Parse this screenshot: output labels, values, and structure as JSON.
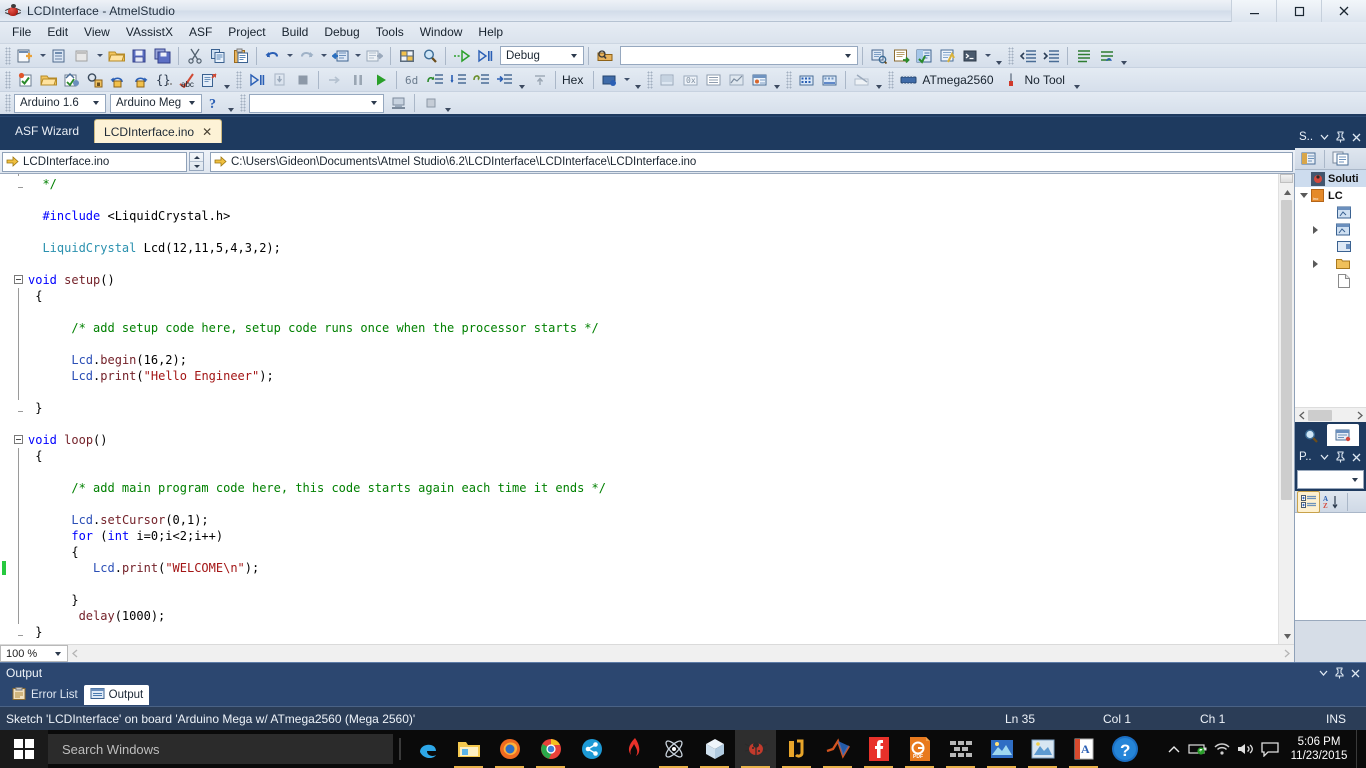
{
  "window": {
    "title": "LCDInterface - AtmelStudio",
    "app_icon": "ladybug-icon",
    "minimize_label": "Minimize",
    "maximize_label": "Maximize",
    "close_label": "Close"
  },
  "menu": {
    "items": [
      "File",
      "Edit",
      "View",
      "VAssistX",
      "ASF",
      "Project",
      "Build",
      "Debug",
      "Tools",
      "Window",
      "Help"
    ]
  },
  "toolbar_row1": {
    "new_project": "new-project-icon",
    "add_item": "add-item-icon",
    "new_file": "new-file-icon",
    "open": "open-folder-icon",
    "save": "save-icon",
    "save_all": "save-all-icon",
    "cut": "cut-icon",
    "copy": "copy-icon",
    "paste": "paste-icon",
    "undo": "undo-icon",
    "redo": "redo-icon",
    "navigate_back": "navigate-back-icon",
    "navigate_forward": "navigate-forward-icon",
    "solution_explorer": "solution-explorer-icon",
    "find": "find-icon",
    "start_debug": "start-debugging-icon",
    "step": "step-icon",
    "configuration": "Debug",
    "find_combo_value": "",
    "find_combo_placeholder": "",
    "quick_find": "quick-find-icon",
    "properties_win": "properties-window-icon",
    "goto": "goto-icon",
    "object_browser": "object-browser-icon",
    "quick_watch": "quick-watch-icon",
    "command_window": "command-window-icon",
    "indent_dec": "decrease-indent-icon",
    "indent_inc": "increase-indent-icon",
    "comment": "comment-icon",
    "uncomment": "uncomment-icon"
  },
  "toolbar_row2": {
    "build_solution": "build-solution-icon",
    "open_file": "open-file-icon",
    "rebuild": "rebuild-icon",
    "find_in_files": "find-in-files-icon",
    "bookmark_prev": "bookmark-prev-icon",
    "bookmark_next": "bookmark-next-icon",
    "braces": "braces-icon",
    "spellcheck": "spellcheck-icon",
    "paste_special": "paste-special-icon",
    "step_over": "step-over-icon",
    "run_to_cursor": "run-to-cursor-icon",
    "stop": "stop-debugging-icon",
    "step_into": "step-into-icon",
    "pause": "pause-icon",
    "start": "start-icon",
    "hex_label": "Hex",
    "disassembly": "disassembly-icon",
    "memory": "memory-icon",
    "processor_view": "processor-view-icon",
    "io_view": "io-view-icon",
    "device_icon": "device-programming-icon",
    "device_label": "ATmega2560",
    "tool_icon": "tool-icon",
    "tool_label": "No Tool"
  },
  "toolbar_row3": {
    "ide_version": "Arduino 1.6",
    "board": "Arduino Meg",
    "help_icon": "help-question-icon",
    "port_combo": "",
    "serial_monitor": "serial-monitor-icon",
    "stop_icon": "stop-square-icon"
  },
  "tabs": {
    "items": [
      {
        "label": "ASF Wizard",
        "active": false,
        "closable": false
      },
      {
        "label": "LCDInterface.ino",
        "active": true,
        "closable": true,
        "close_glyph": "✕"
      }
    ]
  },
  "navbar": {
    "scope_icon": "yellow-arrow-icon",
    "scope": "LCDInterface.ino",
    "path_icon": "yellow-arrow-icon",
    "path": "C:\\Users\\Gideon\\Documents\\Atmel Studio\\6.2\\LCDInterface\\LCDInterface\\LCDInterface.ino"
  },
  "editor": {
    "zoom": "100 %",
    "lines": [
      {
        "indent": 0,
        "tokens": [
          {
            "t": "  ",
            "c": "id"
          },
          {
            "t": "*/",
            "c": "cmt"
          }
        ]
      },
      {
        "indent": 0,
        "tokens": []
      },
      {
        "indent": 0,
        "tokens": [
          {
            "t": "  ",
            "c": "id"
          },
          {
            "t": "#include",
            "c": "pre"
          },
          {
            "t": " <LiquidCrystal.h>",
            "c": "id"
          }
        ]
      },
      {
        "indent": 0,
        "tokens": []
      },
      {
        "indent": 0,
        "tokens": [
          {
            "t": "  ",
            "c": "id"
          },
          {
            "t": "LiquidCrystal",
            "c": "type"
          },
          {
            "t": " Lcd(12,11,5,4,3,2);",
            "c": "id"
          }
        ]
      },
      {
        "indent": 0,
        "tokens": []
      },
      {
        "indent": 0,
        "tokens": [
          {
            "t": "void",
            "c": "kw"
          },
          {
            "t": " ",
            "c": "id"
          },
          {
            "t": "setup",
            "c": "fn"
          },
          {
            "t": "()",
            "c": "id"
          }
        ]
      },
      {
        "indent": 0,
        "tokens": [
          {
            "t": " {",
            "c": "id"
          }
        ]
      },
      {
        "indent": 0,
        "tokens": []
      },
      {
        "indent": 0,
        "tokens": [
          {
            "t": "      ",
            "c": "id"
          },
          {
            "t": "/* add setup code here, setup code runs once when the processor starts */",
            "c": "cmt"
          }
        ]
      },
      {
        "indent": 0,
        "tokens": []
      },
      {
        "indent": 0,
        "tokens": [
          {
            "t": "      ",
            "c": "id"
          },
          {
            "t": "Lcd",
            "c": "obj"
          },
          {
            "t": ".",
            "c": "id"
          },
          {
            "t": "begin",
            "c": "fn"
          },
          {
            "t": "(16,2);",
            "c": "id"
          }
        ]
      },
      {
        "indent": 0,
        "tokens": [
          {
            "t": "      ",
            "c": "id"
          },
          {
            "t": "Lcd",
            "c": "obj"
          },
          {
            "t": ".",
            "c": "id"
          },
          {
            "t": "print",
            "c": "fn"
          },
          {
            "t": "(",
            "c": "id"
          },
          {
            "t": "\"Hello Engineer\"",
            "c": "str"
          },
          {
            "t": ");",
            "c": "id"
          }
        ]
      },
      {
        "indent": 0,
        "tokens": []
      },
      {
        "indent": 0,
        "tokens": [
          {
            "t": " }",
            "c": "id"
          }
        ]
      },
      {
        "indent": 0,
        "tokens": []
      },
      {
        "indent": 0,
        "tokens": [
          {
            "t": "void",
            "c": "kw"
          },
          {
            "t": " ",
            "c": "id"
          },
          {
            "t": "loop",
            "c": "fn"
          },
          {
            "t": "()",
            "c": "id"
          }
        ]
      },
      {
        "indent": 0,
        "tokens": [
          {
            "t": " {",
            "c": "id"
          }
        ]
      },
      {
        "indent": 0,
        "tokens": []
      },
      {
        "indent": 0,
        "tokens": [
          {
            "t": "      ",
            "c": "id"
          },
          {
            "t": "/* add main program code here, this code starts again each time it ends */",
            "c": "cmt"
          }
        ]
      },
      {
        "indent": 0,
        "tokens": []
      },
      {
        "indent": 0,
        "tokens": [
          {
            "t": "      ",
            "c": "id"
          },
          {
            "t": "Lcd",
            "c": "obj"
          },
          {
            "t": ".",
            "c": "id"
          },
          {
            "t": "setCursor",
            "c": "fn"
          },
          {
            "t": "(0,1);",
            "c": "id"
          }
        ]
      },
      {
        "indent": 0,
        "tokens": [
          {
            "t": "      ",
            "c": "id"
          },
          {
            "t": "for",
            "c": "kw"
          },
          {
            "t": " (",
            "c": "id"
          },
          {
            "t": "int",
            "c": "kw"
          },
          {
            "t": " i=0;i<2;i++)",
            "c": "id"
          }
        ]
      },
      {
        "indent": 0,
        "tokens": [
          {
            "t": "      {",
            "c": "id"
          }
        ]
      },
      {
        "indent": 0,
        "tokens": [
          {
            "t": "         ",
            "c": "id"
          },
          {
            "t": "Lcd",
            "c": "obj"
          },
          {
            "t": ".",
            "c": "id"
          },
          {
            "t": "print",
            "c": "fn"
          },
          {
            "t": "(",
            "c": "id"
          },
          {
            "t": "\"WELCOME\\n\"",
            "c": "str"
          },
          {
            "t": ");",
            "c": "id"
          }
        ]
      },
      {
        "indent": 0,
        "tokens": []
      },
      {
        "indent": 0,
        "tokens": [
          {
            "t": "      }",
            "c": "id"
          }
        ]
      },
      {
        "indent": 0,
        "tokens": [
          {
            "t": "       ",
            "c": "id"
          },
          {
            "t": "delay",
            "c": "fn"
          },
          {
            "t": "(1000);",
            "c": "id"
          }
        ]
      },
      {
        "indent": 0,
        "tokens": [
          {
            "t": " }",
            "c": "id"
          }
        ]
      }
    ]
  },
  "solution_explorer": {
    "title": "S..",
    "dropdown_icon": "chevron-down-icon",
    "pin_icon": "pin-icon",
    "close_icon": "close-icon",
    "toolbar": [
      "properties-icon",
      "show-all-files-icon"
    ],
    "root_label": "Soluti",
    "project_label": "LC",
    "scroll_left": "‹",
    "scroll_right": "›"
  },
  "properties_pane": {
    "title": "P..",
    "dropdown_icon": "chevron-down-icon",
    "pin_icon": "pin-icon",
    "close_icon": "close-icon",
    "object_combo": "",
    "categorized_icon": "categorized-icon",
    "alphabetical_icon": "alphabetical-sort-icon"
  },
  "output_panel": {
    "title": "Output",
    "dropdown_icon": "chevron-down-icon",
    "pin_icon": "pin-icon",
    "close_icon": "close-icon",
    "tabs": [
      {
        "label": "Error List",
        "icon": "error-list-icon",
        "active": false
      },
      {
        "label": "Output",
        "icon": "output-icon",
        "active": true
      }
    ]
  },
  "statusbar": {
    "message": "Sketch 'LCDInterface' on board 'Arduino Mega w/ ATmega2560 (Mega 2560)'",
    "line": "Ln 35",
    "col": "Col 1",
    "ch": "Ch 1",
    "insert_mode": "INS"
  },
  "taskbar": {
    "start_icon": "windows-start-icon",
    "search_placeholder": "Search Windows",
    "apps": [
      {
        "name": "edge-icon",
        "running": false
      },
      {
        "name": "file-explorer-icon",
        "running": true
      },
      {
        "name": "firefox-icon",
        "running": true
      },
      {
        "name": "chrome-icon",
        "running": true
      },
      {
        "name": "share-icon",
        "running": false
      },
      {
        "name": "flash-icon",
        "running": false
      },
      {
        "name": "atom-icon",
        "running": true
      },
      {
        "name": "cube-icon",
        "running": true
      },
      {
        "name": "atmel-studio-icon",
        "running": true,
        "active": true
      },
      {
        "name": "proteus-icon",
        "running": true
      },
      {
        "name": "matlab-icon",
        "running": true
      },
      {
        "name": "facebook-icon",
        "running": true
      },
      {
        "name": "pdf-icon",
        "running": true
      },
      {
        "name": "keil-icon",
        "running": true
      },
      {
        "name": "photos-icon",
        "running": true
      },
      {
        "name": "picture-viewer-icon",
        "running": true
      },
      {
        "name": "word-icon",
        "running": true
      },
      {
        "name": "help-icon",
        "running": false
      }
    ],
    "tray": [
      {
        "name": "show-hidden-icons-chevron"
      },
      {
        "name": "battery-icon"
      },
      {
        "name": "wifi-icon"
      },
      {
        "name": "volume-icon"
      },
      {
        "name": "action-center-icon"
      }
    ],
    "time": "5:06 PM",
    "date": "11/23/2015"
  },
  "colors": {
    "chrome": "#1e3a5f",
    "toolbar": "#dfe7f0",
    "active_tab": "#fdf2d6",
    "keyword": "#0000ff",
    "comment": "#008000",
    "string": "#a31515",
    "type": "#2b91af",
    "method": "#74222a",
    "change_marker": "#27c93f",
    "statusbar": "#2b3d57"
  }
}
